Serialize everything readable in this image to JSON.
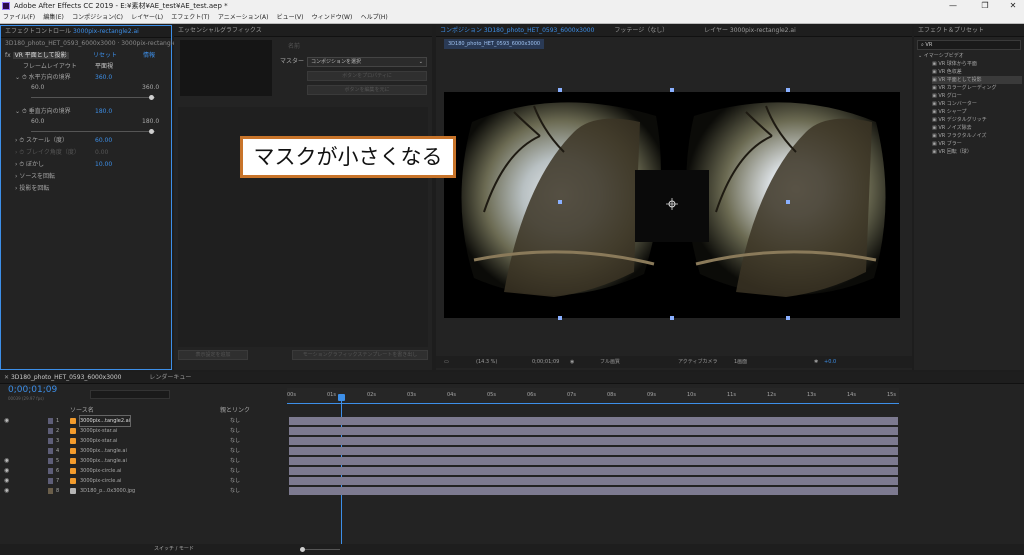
{
  "window": {
    "title": "Adobe After Effects CC 2019 - E:¥素材¥AE_test¥AE_test.aep *",
    "controls": [
      "—",
      "❐",
      "✕"
    ]
  },
  "menu": [
    "ファイル(F)",
    "編集(E)",
    "コンポジション(C)",
    "レイヤー(L)",
    "エフェクト(T)",
    "アニメーション(A)",
    "ビュー(V)",
    "ウィンドウ(W)",
    "ヘルプ(H)"
  ],
  "effect_controls": {
    "tab": "エフェクトコントロール",
    "tab_layer": "3000pix-rectangle2.ai",
    "breadcrumb": "3D180_photo_HET_0593_6000x3000 · 3000pix-rectangle2.ai",
    "effect_name": "VR 平面として投影",
    "reset": "リセット",
    "about": "情報",
    "frame_layout_label": "フレームレイアウト",
    "frame_layout_value": "平面視",
    "h_bound_label": "水平方向の境界",
    "h_bound_value": "360.0",
    "h_min": "60.0",
    "h_max": "360.0",
    "v_bound_label": "垂直方向の境界",
    "v_bound_value": "180.0",
    "v_min": "60.0",
    "v_max": "180.0",
    "scale_label": "スケール（度）",
    "scale_value": "60.00",
    "offset_label": "ブレイク角度（度）",
    "offset_value": "0.00",
    "blur_label": "ぼかし",
    "blur_value": "10.00",
    "source_rot_label": "ソースを回転",
    "proj_rot_label": "投影を回転"
  },
  "essential": {
    "tab": "エッセンシャルグラフィックス",
    "name_label": "名前",
    "master_label": "マスター",
    "master_value": "コンポジションを選択",
    "btn_solo": "ボタンをプロパティに",
    "btn_export": "ボタンを編集を元に",
    "btn_add": "表示設定を追加",
    "btn_motion": "モーショングラフィックステンプレートを書き出し"
  },
  "viewer": {
    "tab_comp": "コンポジション 3D180_photo_HET_0593_6000x3000",
    "tab_footage": "フッテージ（なし）",
    "tab_layer": "レイヤー 3000pix-rectangle2.ai",
    "subtab": "3D180_photo_HET_0593_6000x3000",
    "annotation": "マスクが小さくなる",
    "zoom": "(14.3 %)",
    "timecode": "0;00;01;09",
    "resolution": "フル画質",
    "camera": "アクティブカメラ",
    "views": "1画面",
    "exposure": "+0.0"
  },
  "presets": {
    "tab": "エフェクト＆プリセット",
    "search": "VR",
    "category": "イマーシブビデオ",
    "items": [
      "VR 球体から平面",
      "VR 色収差",
      "VR 平面として投影",
      "VR カラーグレーディング",
      "VR グロー",
      "VR コンバーター",
      "VR シャープ",
      "VR デジタルグリッチ",
      "VR ノイズ除去",
      "VR フラクタルノイズ",
      "VR ブラー",
      "VR 回転（球）"
    ]
  },
  "timeline": {
    "tab": "3D180_photo_HET_0593_6000x3000",
    "render_tab": "レンダーキュー",
    "timecode": "0;00;01;09",
    "frame_info": "00039 (29.97 fps)",
    "col_source": "ソース名",
    "col_parent": "親とリンク",
    "switches_label": "スイッチ / モード",
    "layers": [
      {
        "num": "1",
        "name": "3000pix...tangle2.ai",
        "parent": "なし"
      },
      {
        "num": "2",
        "name": "3000pix-star.ai",
        "parent": "なし"
      },
      {
        "num": "3",
        "name": "3000pix-star.ai",
        "parent": "なし"
      },
      {
        "num": "4",
        "name": "3000pix...tangle.ai",
        "parent": "なし"
      },
      {
        "num": "5",
        "name": "3000pix...tangle.ai",
        "parent": "なし"
      },
      {
        "num": "6",
        "name": "3000pix-circle.ai",
        "parent": "なし"
      },
      {
        "num": "7",
        "name": "3000pix-circle.ai",
        "parent": "なし"
      },
      {
        "num": "8",
        "name": "3D180_p...0x3000.jpg",
        "parent": "なし"
      }
    ],
    "ruler": [
      "00s",
      "01s",
      "02s",
      "03s",
      "04s",
      "05s",
      "06s",
      "07s",
      "08s",
      "09s",
      "10s",
      "11s",
      "12s",
      "13s",
      "14s",
      "15s"
    ]
  },
  "colors": {
    "accent_blue": "#3d8fe8",
    "annotation_border": "#c8742a",
    "layer_bar": "#7d7a90",
    "label_ai": "#f29b2c"
  }
}
